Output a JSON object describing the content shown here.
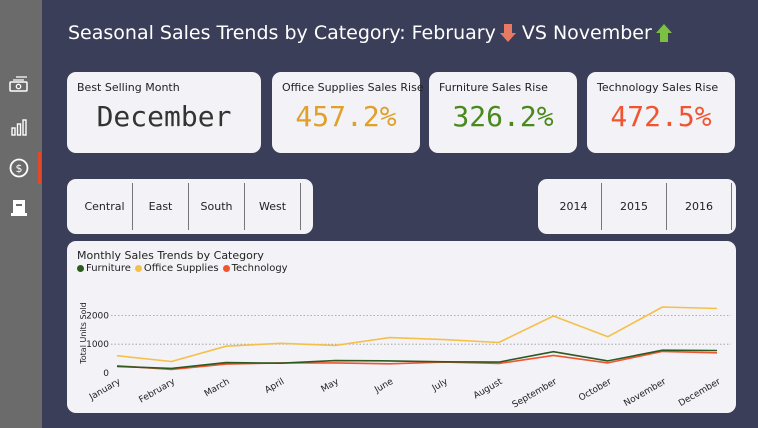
{
  "header": {
    "title_part1": "Seasonal Sales Trends by Category: February",
    "title_part2": "VS November"
  },
  "sidebar": {
    "icons": [
      "money-icon",
      "bar-chart-icon",
      "dollar-cycle-icon",
      "box-icon"
    ],
    "active_index": 2
  },
  "kpis": [
    {
      "label": "Best Selling Month",
      "value": "December",
      "color": "#333333"
    },
    {
      "label": "Office Supplies Sales Rise",
      "value": "457.2%",
      "color": "#e0a02a"
    },
    {
      "label": "Furniture Sales Rise",
      "value": "326.2%",
      "color": "#4a8a1c"
    },
    {
      "label": "Technology Sales Rise",
      "value": "472.5%",
      "color": "#ef5530"
    }
  ],
  "region_slicer": [
    "Central",
    "East",
    "South",
    "West"
  ],
  "year_slicer": [
    "2014",
    "2015",
    "2016"
  ],
  "chart_data": {
    "type": "line",
    "title": "Monthly Sales Trends by Category",
    "ylabel": "Total Units Sold",
    "xlabel": "",
    "ylim": [
      0,
      2500
    ],
    "yticks": [
      0,
      1000,
      2000
    ],
    "grid": true,
    "legend_position": "top-left",
    "categories": [
      "January",
      "February",
      "March",
      "April",
      "May",
      "June",
      "July",
      "August",
      "September",
      "October",
      "November",
      "December"
    ],
    "series": [
      {
        "name": "Furniture",
        "color": "#2d5a1e",
        "values": [
          230,
          160,
          360,
          340,
          430,
          420,
          390,
          380,
          740,
          420,
          790,
          780
        ]
      },
      {
        "name": "Office Supplies",
        "color": "#f5c04a",
        "values": [
          600,
          400,
          930,
          1030,
          960,
          1230,
          1160,
          1060,
          1980,
          1260,
          2290,
          2240
        ]
      },
      {
        "name": "Technology",
        "color": "#ef5530",
        "values": [
          250,
          120,
          310,
          350,
          350,
          320,
          380,
          330,
          610,
          350,
          750,
          700
        ]
      }
    ]
  }
}
